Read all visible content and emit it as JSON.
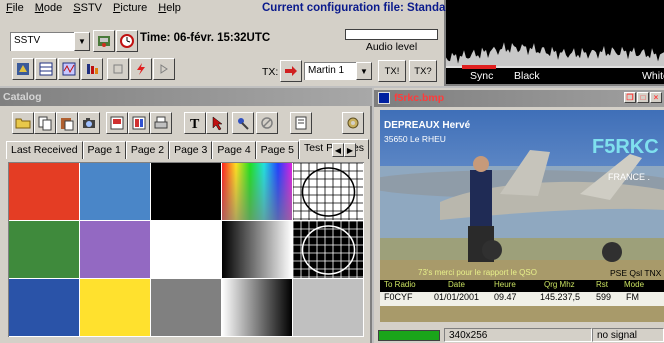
{
  "menu": [
    {
      "label": "File",
      "underline": "F",
      "rest": "ile"
    },
    {
      "label": "Mode",
      "underline": "M",
      "rest": "ode"
    },
    {
      "label": "SSTV",
      "underline": "S",
      "rest": "STV"
    },
    {
      "label": "Picture",
      "underline": "P",
      "rest": "icture"
    },
    {
      "label": "Help",
      "underline": "H",
      "rest": "elp"
    }
  ],
  "config_title": "Current configuration file: Standard",
  "mode_select": "SSTV",
  "time": "Time: 06-févr. 15:32UTC",
  "audio_level_label": "Audio level",
  "tx_label": "TX:",
  "tx_mode": "Martin 1",
  "tx_buttons": [
    "TX!",
    "TX?"
  ],
  "spectrum": {
    "labels": [
      "Sync",
      "Black",
      "White"
    ]
  },
  "catalog": {
    "title": "Catalog",
    "tabs": [
      "Last Received",
      "Page 1",
      "Page 2",
      "Page 3",
      "Page 4",
      "Page 5",
      "Test Pictures"
    ],
    "active_tab": "Test Pictures",
    "tiles": [
      {
        "kind": "solid",
        "color": "#e43d24"
      },
      {
        "kind": "solid",
        "color": "#4a86c8"
      },
      {
        "kind": "solid",
        "color": "#000000"
      },
      {
        "kind": "rainbow"
      },
      {
        "kind": "grid-circle"
      },
      {
        "kind": "solid",
        "color": "#3f8a3c"
      },
      {
        "kind": "solid",
        "color": "#9369c2"
      },
      {
        "kind": "solid",
        "color": "#ffffff"
      },
      {
        "kind": "gradient"
      },
      {
        "kind": "grid-circle-dark"
      },
      {
        "kind": "solid",
        "color": "#2a53a8"
      },
      {
        "kind": "solid",
        "color": "#ffe12e"
      },
      {
        "kind": "solid",
        "color": "#808080"
      },
      {
        "kind": "gradient-half"
      },
      {
        "kind": "solid",
        "color": "#c0c0c0"
      }
    ]
  },
  "image_window": {
    "title": "f5rkc.bmp",
    "overlay": {
      "name": "DEPREAUX Hervé",
      "address": "35650 Le RHEU",
      "callsign": "F5RKC",
      "country": "FRANCE .",
      "thanks": "73's merci pour le rapport le QSO",
      "pse": "PSE Qsl TNX",
      "table_headers": [
        "To Radio",
        "Date",
        "Heure",
        "Qrg Mhz",
        "Rst",
        "Mode"
      ],
      "table_row": [
        "F0CYF",
        "01/01/2001",
        "09.47",
        "145.237,5",
        "599",
        "FM"
      ]
    }
  },
  "status": {
    "size": "340x256",
    "signal": "no signal"
  }
}
